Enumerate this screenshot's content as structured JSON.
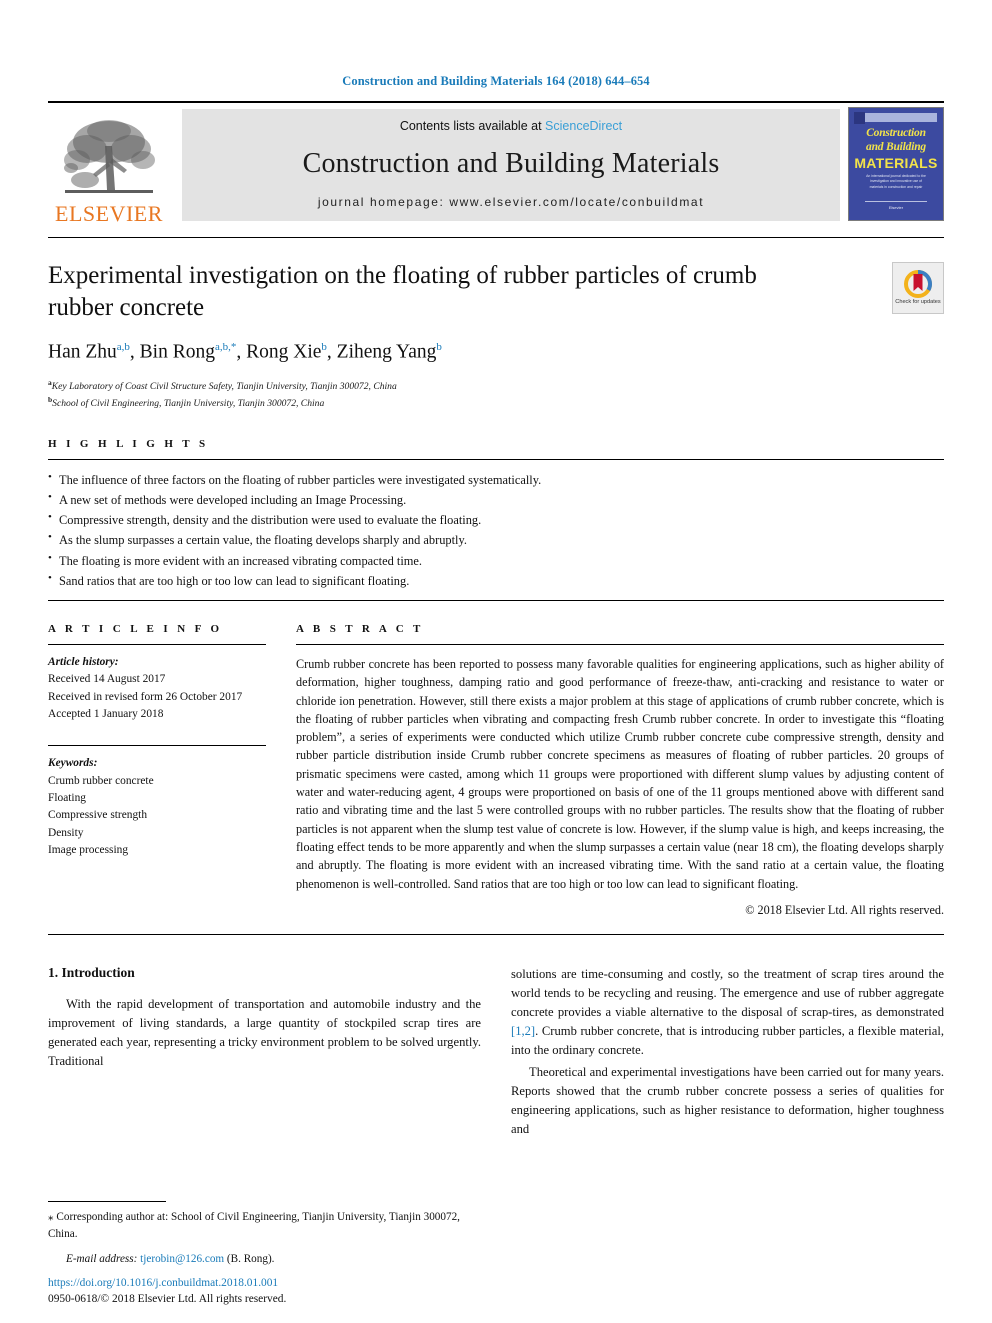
{
  "running_head": "Construction and Building Materials 164 (2018) 644–654",
  "masthead": {
    "publisher_logo_text": "ELSEVIER",
    "contents_prefix": "Contents lists available at",
    "contents_link": "ScienceDirect",
    "journal_name": "Construction and Building Materials",
    "homepage": "journal homepage: www.elsevier.com/locate/conbuildmat",
    "cover": {
      "line1": "Construction",
      "line2": "and Building",
      "line3": "MATERIALS",
      "blurb": "An international journal dedicated to the investigation and innovative use of materials in construction and repair",
      "foot": "Elsevier"
    }
  },
  "article": {
    "title": "Experimental investigation on the floating of rubber particles of crumb rubber concrete",
    "crossmark_caption": "Check for updates",
    "authors": [
      {
        "name": "Han Zhu",
        "sup": "a,b",
        "sep": ", "
      },
      {
        "name": "Bin Rong",
        "sup": "a,b,",
        "star": "*",
        "sep": ", "
      },
      {
        "name": "Rong Xie",
        "sup": "b",
        "sep": ", "
      },
      {
        "name": "Ziheng Yang",
        "sup": "b",
        "sep": ""
      }
    ],
    "affiliations": [
      {
        "marker": "a",
        "text": "Key Laboratory of Coast Civil Structure Safety, Tianjin University, Tianjin 300072, China"
      },
      {
        "marker": "b",
        "text": "School of Civil Engineering, Tianjin University, Tianjin 300072, China"
      }
    ]
  },
  "highlights": {
    "heading": "H I G H L I G H T S",
    "items": [
      "The influence of three factors on the floating of rubber particles were investigated systematically.",
      "A new set of methods were developed including an Image Processing.",
      "Compressive strength, density and the distribution were used to evaluate the floating.",
      "As the slump surpasses a certain value, the floating develops sharply and abruptly.",
      "The floating is more evident with an increased vibrating compacted time.",
      "Sand ratios that are too high or too low can lead to significant floating."
    ]
  },
  "article_info": {
    "heading": "A R T I C L E   I N F O",
    "history_label": "Article history:",
    "history": [
      "Received 14 August 2017",
      "Received in revised form 26 October 2017",
      "Accepted 1 January 2018"
    ],
    "keywords_label": "Keywords:",
    "keywords": [
      "Crumb rubber concrete",
      "Floating",
      "Compressive strength",
      "Density",
      "Image processing"
    ]
  },
  "abstract": {
    "heading": "A B S T R A C T",
    "body": "Crumb rubber concrete has been reported to possess many favorable qualities for engineering applications, such as higher ability of deformation, higher toughness, damping ratio and good performance of freeze-thaw, anti-cracking and resistance to water or chloride ion penetration. However, still there exists a major problem at this stage of applications of crumb rubber concrete, which is the floating of rubber particles when vibrating and compacting fresh Crumb rubber concrete. In order to investigate this “floating problem”, a series of experiments were conducted which utilize Crumb rubber concrete cube compressive strength, density and rubber particle distribution inside Crumb rubber concrete specimens as measures of floating of rubber particles. 20 groups of prismatic specimens were casted, among which 11 groups were proportioned with different slump values by adjusting content of water and water-reducing agent, 4 groups were proportioned on basis of one of the 11 groups mentioned above with different sand ratio and vibrating time and the last 5 were controlled groups with no rubber particles. The results show that the floating of rubber particles is not apparent when the slump test value of concrete is low. However, if the slump value is high, and keeps increasing, the floating effect tends to be more apparently and when the slump surpasses a certain value (near 18 cm), the floating develops sharply and abruptly. The floating is more evident with an increased vibrating time. With the sand ratio at a certain value, the floating phenomenon is well-controlled. Sand ratios that are too high or too low can lead to significant floating.",
    "copyright": "© 2018 Elsevier Ltd. All rights reserved."
  },
  "introduction": {
    "heading": "1. Introduction",
    "left_paragraph": "With the rapid development of transportation and automobile industry and the improvement of living standards, a large quantity of stockpiled scrap tires are generated each year, representing a tricky environment problem to be solved urgently. Traditional",
    "right_paragraph_1_part1": "solutions are time-consuming and costly, so the treatment of scrap tires around the world tends to be recycling and reusing. The emergence and use of rubber aggregate concrete provides a viable alternative to the disposal of scrap-tires, as demonstrated ",
    "right_paragraph_1_ref": "[1,2]",
    "right_paragraph_1_part2": ". Crumb rubber concrete, that is introducing rubber particles, a flexible material, into the ordinary concrete.",
    "right_paragraph_2": "Theoretical and experimental investigations have been carried out for many years. Reports showed that the crumb rubber concrete possess a series of qualities for engineering applications, such as higher resistance to deformation, higher toughness and"
  },
  "footer": {
    "corresponding_marker": "⁎",
    "corresponding_text": "Corresponding author at: School of Civil Engineering, Tianjin University, Tianjin 300072, China.",
    "email_label": "E-mail address:",
    "email": "tjerobin@126.com",
    "email_owner": "(B. Rong).",
    "doi": "https://doi.org/10.1016/j.conbuildmat.2018.01.001",
    "issn_line": "0950-0618/© 2018 Elsevier Ltd. All rights reserved."
  },
  "colors": {
    "link_blue": "#1a7bb9",
    "sciencedirect_blue": "#3a9fd6",
    "elsevier_orange": "#e87722",
    "cover_blue": "#3c4aa0",
    "cover_yellow": "#f2e34a",
    "band_gray": "#e3e3e3"
  }
}
